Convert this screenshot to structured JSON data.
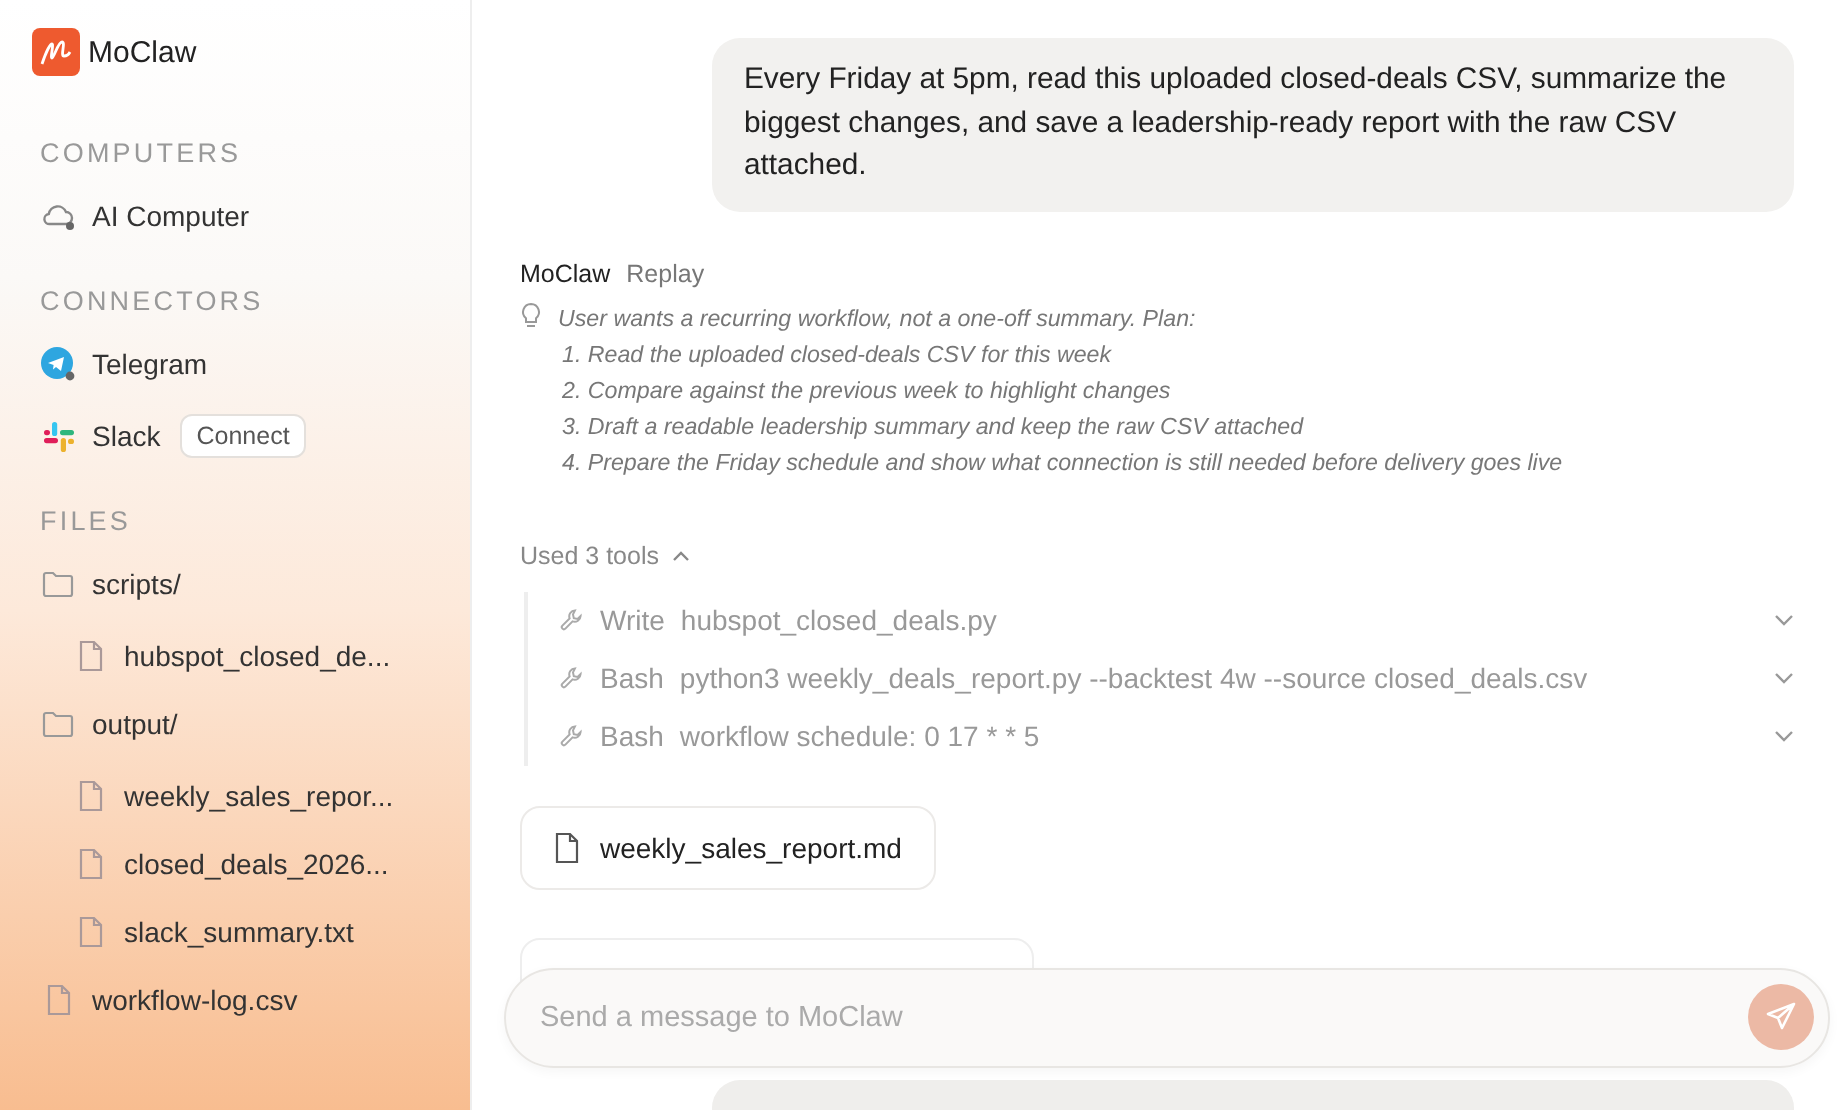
{
  "sidebar": {
    "logo": "MoClaw",
    "sections": [
      {
        "title": "COMPUTERS",
        "items": [
          {
            "kind": "computer",
            "label": "AI Computer"
          }
        ]
      },
      {
        "title": "CONNECTORS",
        "items": [
          {
            "kind": "telegram",
            "label": "Telegram"
          },
          {
            "kind": "slack",
            "label": "Slack",
            "action": "Connect"
          }
        ]
      },
      {
        "title": "FILES",
        "items": [
          {
            "kind": "folder",
            "label": "scripts/",
            "children": [
              {
                "kind": "file",
                "label": "hubspot_closed_de..."
              }
            ]
          },
          {
            "kind": "folder",
            "label": "output/",
            "children": [
              {
                "kind": "file",
                "label": "weekly_sales_repor..."
              },
              {
                "kind": "file",
                "label": "closed_deals_2026..."
              },
              {
                "kind": "file",
                "label": "slack_summary.txt"
              }
            ]
          },
          {
            "kind": "file",
            "label": "workflow-log.csv"
          }
        ]
      }
    ]
  },
  "chat": {
    "user_message": "Every Friday at 5pm, read this uploaded closed-deals CSV, summarize the biggest changes, and save a leadership-ready report with the raw CSV attached.",
    "assistant": {
      "name": "MoClaw",
      "replay": "Replay",
      "thinking": [
        "User wants a recurring workflow, not a one-off summary. Plan:",
        "1. Read the uploaded closed-deals CSV for this week",
        "2. Compare against the previous week to highlight changes",
        "3. Draft a readable leadership summary and keep the raw CSV attached",
        "4. Prepare the Friday schedule and show what connection is still needed before delivery goes live"
      ],
      "tools_summary": {
        "label": "Used 3 tools",
        "expanded": true
      },
      "tools": [
        {
          "name": "Write",
          "argument": "hubspot_closed_deals.py",
          "expanded": false
        },
        {
          "name": "Bash",
          "argument": "python3 weekly_deals_report.py --backtest 4w --source closed_deals.csv",
          "expanded": false
        },
        {
          "name": "Bash",
          "argument": "workflow schedule: 0 17 * * 5",
          "expanded": false
        }
      ],
      "attachment": "weekly_sales_report.md"
    },
    "composer": {
      "placeholder": "Send a message to MoClaw"
    }
  }
}
